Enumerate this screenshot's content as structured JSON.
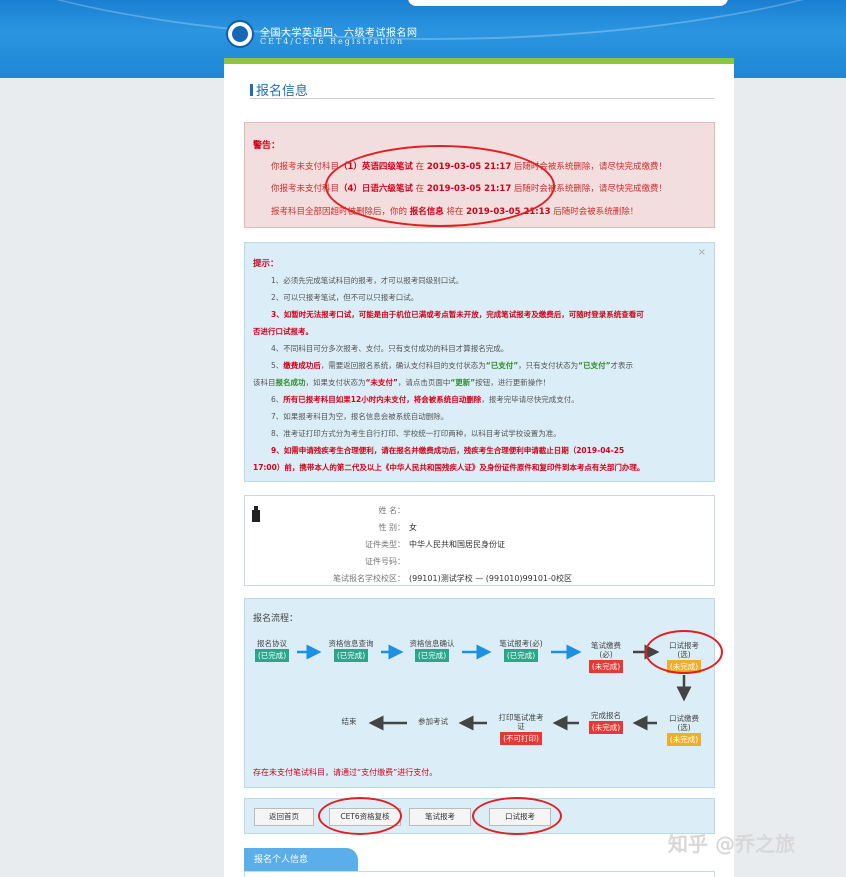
{
  "header": {
    "site_title": "全国大学英语四、六级考试报名网",
    "site_subtitle": "CET4/CET6  Registration"
  },
  "page_title": "报名信息",
  "warning": {
    "heading": "警告：",
    "lines": [
      {
        "pre": "你报考未支付科目",
        "subject": "（1）英语四级笔试",
        "mid": " 在 ",
        "time": "2019-03-05 21:17",
        "post": " 后随时会被系统删除，请尽快完成缴费！"
      },
      {
        "pre": "你报考未支付科目",
        "subject": "（4）日语六级笔试",
        "mid": " 在 ",
        "time": "2019-03-05 21:17",
        "post": " 后随时会被系统删除，请尽快完成缴费！"
      },
      {
        "pre": "报考科目全部因超时被删除后，你的 ",
        "subject": "报名信息",
        "mid": " 将在 ",
        "time": "2019-03-05 21:13",
        "post": " 后随时会被系统删除！"
      }
    ]
  },
  "tips": {
    "heading": "提示：",
    "close": "×",
    "t1": "1、必须先完成笔试科目的报考，才可以报考同级别口试。",
    "t2": "2、可以只报考笔试，但不可以只报考口试。",
    "t3a": "3、如暂时无法报考口试，可能是由于机位已满或考点暂未开放，完成笔试报考及缴费后，可随时登录系统查看可",
    "t3b": "否进行口试报考。",
    "t4": "4、不同科目可分多次报考、支付。只有支付成功的科目才算报名完成。",
    "t5a_1": "5、",
    "t5a_2": "缴费成功后",
    "t5a_3": "，需要返回报名系统，确认支付科目的支付状态为",
    "t5a_4": "“已支付”",
    "t5a_5": "，只有支付状态为",
    "t5a_6": "“已支付”",
    "t5a_7": "才表示",
    "t5b_1": "该科目",
    "t5b_2": "报名成功",
    "t5b_3": "，如果支付状态为",
    "t5b_4": "“未支付”",
    "t5b_5": "，请点击页面中",
    "t5b_6": "“更新”",
    "t5b_7": "按钮，进行更新操作！",
    "t6_1": "6、",
    "t6_2": "所有已报考科目如果12小时内未支付，将会被系统自动删除",
    "t6_3": "，报考完毕请尽快完成支付。",
    "t7": "7、如果报考科目为空，报名信息会被系统自动删除。",
    "t8": "8、准考证打印方式分为考生自行打印、学校统一打印两种，以科目考试学校设置为准。",
    "t9a": "9、如需申请残疾考生合理便利，请在报名并缴费成功后，残疾考生合理便利申请截止日期（2019-04-25",
    "t9b": "17:00）前，携带本人的第二代及以上《中华人民共和国残疾人证》及身份证件原件和复印件到本考点有关部门办理。"
  },
  "info": {
    "name_label": "姓    名：",
    "name_value": "",
    "gender_label": "性    别：",
    "gender_value": "女",
    "id_type_label": "证件类型：",
    "id_type_value": "中华人民共和国居民身份证",
    "id_no_label": "证件号码：",
    "id_no_value": "",
    "campus_label": "笔试报名学校校区：",
    "campus_value": "(99101)测试学校 — (991010)99101-0校区"
  },
  "flow": {
    "heading": "报名流程：",
    "steps": [
      {
        "label": "报名协议",
        "status": "(已完成)"
      },
      {
        "label": "资格信息查询",
        "status": "(已完成)"
      },
      {
        "label": "资格信息确认",
        "status": "(已完成)"
      },
      {
        "label": "笔试报考(必)",
        "status": "(已完成)"
      },
      {
        "label": "笔试缴费\n(必)",
        "status": "(未完成)"
      },
      {
        "label": "口试报考\n(选)",
        "status": "(未完成)"
      },
      {
        "label": "口试缴费\n(选)",
        "status": "(未完成)"
      },
      {
        "label": "完成报名",
        "status": "(未完成)"
      },
      {
        "label": "打印笔试准考\n证",
        "status": "(不可打印)"
      },
      {
        "label": "参加考试",
        "status": ""
      },
      {
        "label": "结束",
        "status": ""
      }
    ],
    "footer": "存在未支付笔试科目，请通过“支付缴费”进行支付。"
  },
  "buttons": {
    "home": "返回首页",
    "cet6": "CET6资格复核",
    "written": "笔试报考",
    "oral": "口试报考"
  },
  "personal_tab": "报名个人信息",
  "watermark": "知乎 @乔之旅",
  "colors": {
    "header_blue": "#1e86d6",
    "done_green": "#2aa78a",
    "undone_red": "#e53935",
    "optional_yellow": "#f0ad2c",
    "warn_red": "#d0021b"
  }
}
